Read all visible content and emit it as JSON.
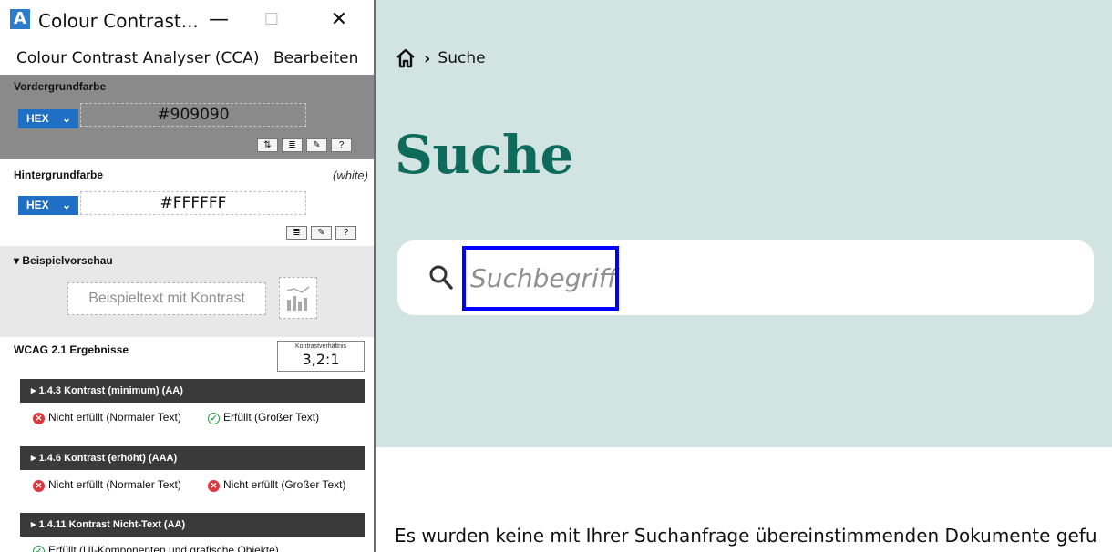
{
  "cca": {
    "window_title": "Colour Contrast...",
    "min_glyph": "—",
    "max_glyph": "☐",
    "close_glyph": "✕",
    "menu": {
      "app": "Colour Contrast Analyser (CCA)",
      "edit": "Bearbeiten"
    },
    "foreground": {
      "label": "Vordergrundfarbe",
      "format": "HEX",
      "value": "#909090",
      "tools": [
        "⇅",
        "≣",
        "✎",
        "?"
      ]
    },
    "background": {
      "label": "Hintergrundfarbe",
      "name_tag": "(white)",
      "format": "HEX",
      "value": "#FFFFFF",
      "tools": [
        "≣",
        "✎",
        "?"
      ]
    },
    "preview": {
      "label": "▾ Beispielvorschau",
      "sample_text": "Beispieltext mit Kontrast"
    },
    "results": {
      "title": "WCAG 2.1 Ergebnisse",
      "ratio_label": "Kontrastverhältnis",
      "ratio_value": "3,2:1",
      "criteria": [
        {
          "heading": "▸ 1.4.3 Kontrast (minimum) (AA)",
          "normal": "Nicht erfüllt (Normaler Text)",
          "large": "Erfüllt (Großer Text)"
        },
        {
          "heading": "▸ 1.4.6 Kontrast (erhöht) (AAA)",
          "normal": "Nicht erfüllt (Normaler Text)",
          "large": "Nicht erfüllt (Großer Text)"
        },
        {
          "heading": "▸ 1.4.11 Kontrast Nicht-Text (AA)",
          "normal": "Erfüllt (UI-Komponenten und grafische Objekte)"
        }
      ]
    },
    "colors": {
      "fail": "#d9383e",
      "pass": "#2a9d40",
      "hex_button": "#1f6fc4"
    }
  },
  "site": {
    "breadcrumb": {
      "separator": "›",
      "current": "Suche"
    },
    "title": "Suche",
    "search_placeholder": "Suchbegriff",
    "result_text": "Es wurden keine mit Ihrer Suchanfrage übereinstimmenden Dokumente gefu",
    "colors": {
      "header_bg": "#d2e4e1",
      "title": "#0e6b5c",
      "highlight": "#0000ff"
    }
  }
}
